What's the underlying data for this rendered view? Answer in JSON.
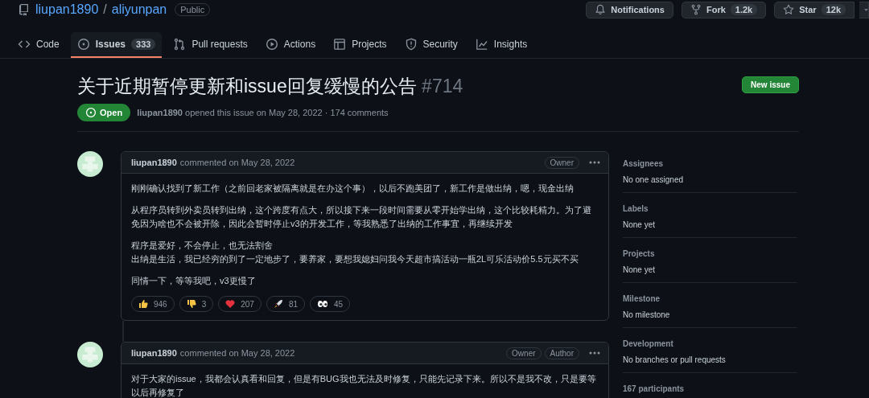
{
  "repo": {
    "owner": "liupan1890",
    "separator": "/",
    "name": "aliyunpan",
    "visibility": "Public"
  },
  "repo_actions": [
    {
      "kind": "bell",
      "label": "Notifications"
    },
    {
      "kind": "fork",
      "label": "Fork",
      "count": "1.2k"
    },
    {
      "kind": "star",
      "label": "Star",
      "count": "12k"
    }
  ],
  "tabs": [
    {
      "kind": "code",
      "label": "Code",
      "selected": false
    },
    {
      "kind": "issue",
      "label": "Issues",
      "count": "333",
      "selected": true
    },
    {
      "kind": "pr",
      "label": "Pull requests",
      "selected": false
    },
    {
      "kind": "play",
      "label": "Actions",
      "selected": false
    },
    {
      "kind": "table",
      "label": "Projects",
      "selected": false
    },
    {
      "kind": "shield",
      "label": "Security",
      "selected": false
    },
    {
      "kind": "graph",
      "label": "Insights",
      "selected": false
    }
  ],
  "issue": {
    "title": "关于近期暂停更新和issue回复缓慢的公告",
    "number": "#714",
    "state": "Open",
    "author": "liupan1890",
    "meta": "opened this issue on May 28, 2022 · 174 comments",
    "new_button": "New issue"
  },
  "comments": [
    {
      "author": "liupan1890",
      "date": "commented on May 28, 2022",
      "badges": [
        "Owner"
      ],
      "paragraphs": [
        [
          "刚刚确认找到了新工作（之前回老家被隔离就是在办这个事），以后不跑美团了，新工作是做出纳，嗯，现金出纳"
        ],
        [
          "从程序员转到外卖员转到出纳，这个跨度有点大，所以接下来一段时间需要从零开始学出纳，这个比较耗精力。为了避免因为啥也不会被开除，因此会暂时停止v3的开发工作，等我熟悉了出纳的工作事宜，再继续开发"
        ],
        [
          "程序是爱好，不会停止，也无法割舍",
          "出纳是生活，我已经穷的到了一定地步了，要养家，要想我媳妇问我今天超市搞活动一瓶2L可乐活动价5.5元买不买"
        ],
        [
          "同情一下，等等我吧，v3更慢了"
        ]
      ],
      "reactions": [
        {
          "kind": "thumbs_up",
          "count": "946"
        },
        {
          "kind": "thumbs_down",
          "count": "3"
        },
        {
          "kind": "heart",
          "count": "207"
        },
        {
          "kind": "rocket",
          "count": "81"
        },
        {
          "kind": "eyes",
          "count": "45"
        }
      ]
    },
    {
      "author": "liupan1890",
      "date": "commented on May 28, 2022",
      "badges": [
        "Owner",
        "Author"
      ],
      "paragraphs": [
        [
          "对于大家的issue，我都会认真看和回复，但是有BUG我也无法及时修复，只能先记录下来。所以不是我不改，只是要等以后再修复了"
        ]
      ]
    }
  ],
  "sidebar": [
    {
      "heading": "Assignees",
      "value": "No one assigned"
    },
    {
      "heading": "Labels",
      "value": "None yet"
    },
    {
      "heading": "Projects",
      "value": "None yet"
    },
    {
      "heading": "Milestone",
      "value": "No milestone"
    },
    {
      "heading": "Development",
      "value": "No branches or pull requests"
    },
    {
      "heading": "167 participants"
    }
  ]
}
